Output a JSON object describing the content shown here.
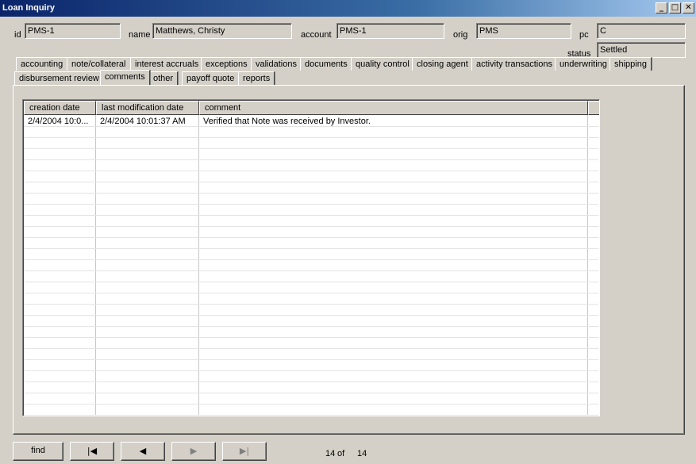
{
  "window": {
    "title": "Loan Inquiry",
    "controls": [
      "minimize-icon",
      "maximize-icon",
      "close-icon"
    ]
  },
  "header": {
    "id_label": "id",
    "id_value": "PMS-1",
    "name_label": "name",
    "name_value": "Matthews, Christy",
    "account_label": "account",
    "account_value": "PMS-1",
    "orig_label": "orig",
    "orig_value": "PMS",
    "pc_label": "pc",
    "pc_value": "C",
    "status_label": "status",
    "status_value": "Settled"
  },
  "tabs_row1": [
    "accounting",
    "note/collateral",
    "interest accruals",
    "exceptions",
    "validations",
    "documents",
    "quality control",
    "closing agent",
    "activity transactions",
    "underwriting",
    "shipping"
  ],
  "tabs_row2": [
    "disbursement review",
    "comments",
    "other",
    "payoff quote",
    "reports"
  ],
  "active_tab": "comments",
  "table": {
    "columns": [
      "creation date",
      "last modification date",
      "comment"
    ],
    "rows": [
      [
        "2/4/2004 10:0...",
        "2/4/2004 10:01:37 AM",
        "Verified that Note was received by Investor."
      ]
    ]
  },
  "footer": {
    "find_label": "find",
    "record_current": "14",
    "record_of": "of",
    "record_total": "14",
    "nav_icons": [
      "first-record-icon",
      "previous-record-icon",
      "next-record-icon",
      "last-record-icon"
    ]
  }
}
